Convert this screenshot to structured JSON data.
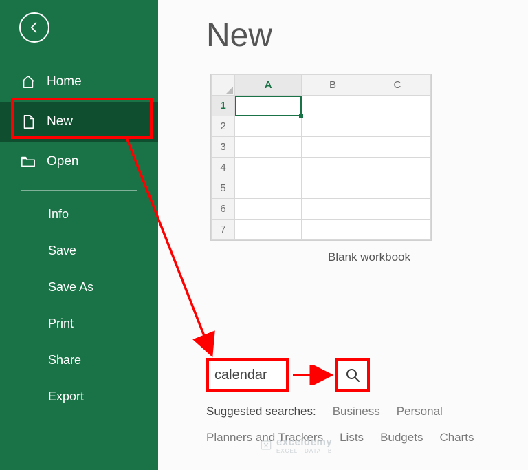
{
  "sidebar": {
    "nav": {
      "home": "Home",
      "new": "New",
      "open": "Open"
    },
    "sub": {
      "info": "Info",
      "save": "Save",
      "saveas": "Save As",
      "print": "Print",
      "share": "Share",
      "export": "Export"
    }
  },
  "main": {
    "title": "New",
    "blank_template_label": "Blank workbook",
    "preview": {
      "columns": [
        "A",
        "B",
        "C"
      ],
      "rows": [
        "1",
        "2",
        "3",
        "4",
        "5",
        "6",
        "7"
      ]
    }
  },
  "search": {
    "value": "calendar",
    "suggested_label": "Suggested searches:",
    "suggestions": [
      "Business",
      "Personal",
      "Planners and Trackers",
      "Lists",
      "Budgets",
      "Charts"
    ]
  },
  "watermark": {
    "brand": "exceldemy",
    "tagline": "EXCEL · DATA · BI"
  }
}
